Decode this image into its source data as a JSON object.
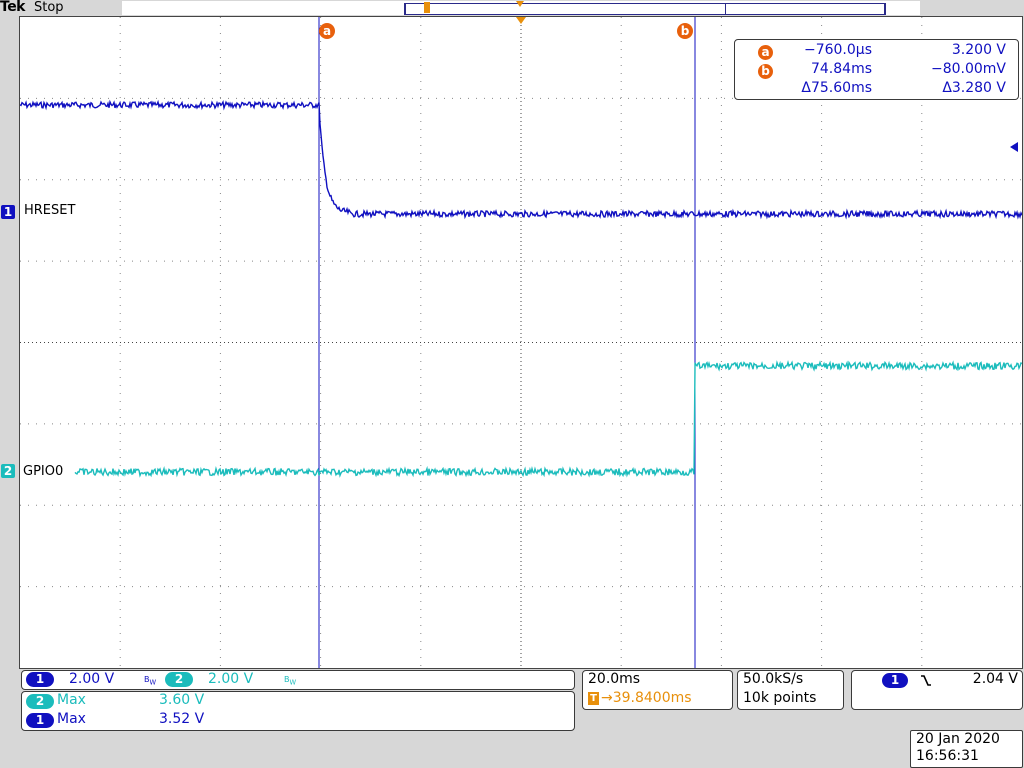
{
  "header": {
    "brand": "Tek",
    "state": "Stop"
  },
  "trigger_marker": "T",
  "channels": [
    {
      "number": "1",
      "name": "HRESET",
      "color": "#1010c0"
    },
    {
      "number": "2",
      "name": "GPIO0",
      "color": "#1bbcbc"
    }
  ],
  "cursors": {
    "a": {
      "label": "a",
      "time": "−760.0µs",
      "volt": "3.200 V"
    },
    "b": {
      "label": "b",
      "time": "74.84ms",
      "volt": "−80.00mV"
    },
    "delta": {
      "time": "Δ75.60ms",
      "volt": "Δ3.280 V"
    }
  },
  "vertical": {
    "ch1_scale": "2.00 V",
    "ch2_scale": "2.00 V",
    "bw_mark": "B",
    "bw_sub": "W"
  },
  "horizontal": {
    "scale": "20.0ms",
    "trigger_pos": "→39.8400ms"
  },
  "acquisition": {
    "rate": "50.0kS/s",
    "points": "10k points"
  },
  "trigger": {
    "source": "1",
    "slope_icon": "falling-edge",
    "level": "2.04 V"
  },
  "measurements": [
    {
      "ch": "2",
      "type": "Max",
      "value": "3.60 V"
    },
    {
      "ch": "1",
      "type": "Max",
      "value": "3.52 V"
    }
  ],
  "datetime": {
    "date": "20 Jan  2020",
    "time": "16:56:31"
  }
}
